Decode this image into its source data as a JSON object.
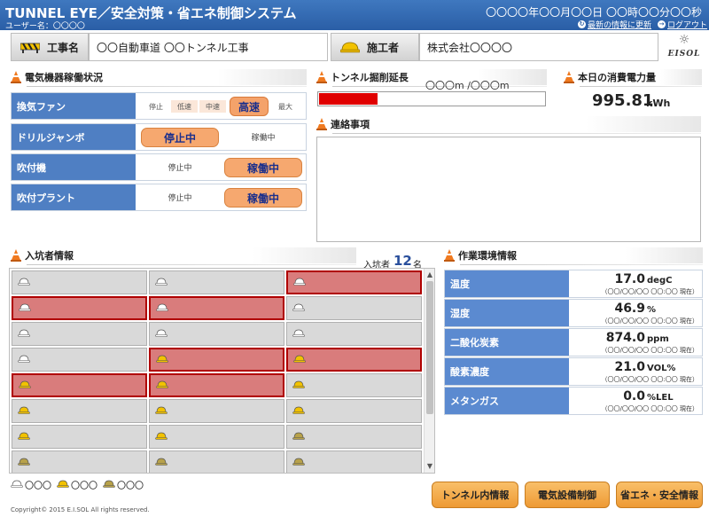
{
  "app": {
    "title": "TUNNEL EYE／安全対策・省エネ制御システム",
    "user_label": "ユーザー名：〇〇〇〇",
    "datetime": "〇〇〇〇年〇〇月〇〇日 〇〇時〇〇分〇〇秒",
    "refresh_link": "最新の情報に更新",
    "logout_link": "ログアウト",
    "logo_text": "EISOL"
  },
  "header": {
    "project_label": "工事名",
    "project_value": "〇〇自動車道 〇〇トンネル工事",
    "contractor_label": "施工者",
    "contractor_value": "株式会社〇〇〇〇"
  },
  "equipment": {
    "title": "電気機器稼働状況",
    "fan": {
      "name": "換気ファン",
      "options": [
        "停止",
        "低速",
        "中速",
        "高速",
        "最大"
      ],
      "selected": "高速"
    },
    "rows": [
      {
        "name": "ドリルジャンボ",
        "stop": "停止中",
        "run": "稼働中",
        "state": "stop"
      },
      {
        "name": "吹付機",
        "stop": "停止中",
        "run": "稼働中",
        "state": "run"
      },
      {
        "name": "吹付プラント",
        "stop": "停止中",
        "run": "稼働中",
        "state": "run"
      }
    ]
  },
  "excavation": {
    "title": "トンネル掘削延長",
    "text": "〇〇〇m /〇〇〇m",
    "progress": 0.26,
    "color": "#e00000"
  },
  "power": {
    "title": "本日の消費電力量",
    "value": "995.81",
    "unit": "kWh"
  },
  "notice": {
    "title": "連絡事項"
  },
  "workers": {
    "title": "入坑者情報",
    "count_label": "入坑者",
    "count": "12",
    "count_unit": "名",
    "rows": [
      [
        {
          "helmet": "white",
          "alert": false
        },
        {
          "helmet": "white",
          "alert": false
        },
        {
          "helmet": "white",
          "alert": true
        }
      ],
      [
        {
          "helmet": "white",
          "alert": true
        },
        {
          "helmet": "white",
          "alert": true
        },
        {
          "helmet": "white",
          "alert": false
        }
      ],
      [
        {
          "helmet": "white",
          "alert": false
        },
        {
          "helmet": "white",
          "alert": false
        },
        {
          "helmet": "white",
          "alert": false
        }
      ],
      [
        {
          "helmet": "white",
          "alert": false
        },
        {
          "helmet": "yellow",
          "alert": true
        },
        {
          "helmet": "yellow",
          "alert": true
        }
      ],
      [
        {
          "helmet": "yellow",
          "alert": true
        },
        {
          "helmet": "yellow",
          "alert": true
        },
        {
          "helmet": "yellow",
          "alert": false
        }
      ],
      [
        {
          "helmet": "yellow",
          "alert": false
        },
        {
          "helmet": "yellow",
          "alert": false
        },
        {
          "helmet": "yellow",
          "alert": false
        }
      ],
      [
        {
          "helmet": "yellow",
          "alert": false
        },
        {
          "helmet": "yellow",
          "alert": false
        },
        {
          "helmet": "olive",
          "alert": false
        }
      ],
      [
        {
          "helmet": "olive",
          "alert": false
        },
        {
          "helmet": "olive",
          "alert": false
        },
        {
          "helmet": "olive",
          "alert": false
        }
      ]
    ],
    "legend": [
      {
        "helmet": "white",
        "label": "〇〇〇"
      },
      {
        "helmet": "yellow",
        "label": "〇〇〇"
      },
      {
        "helmet": "olive",
        "label": "〇〇〇"
      }
    ],
    "helmet_colors": {
      "white": "#ffffff",
      "yellow": "#f2c200",
      "olive": "#b8a24a"
    }
  },
  "environment": {
    "title": "作業環境情報",
    "timestamp": "（〇〇/〇〇/〇〇 〇〇:〇〇 現在）",
    "rows": [
      {
        "name": "温度",
        "value": "17.0",
        "unit": "degC"
      },
      {
        "name": "湿度",
        "value": "46.9",
        "unit": "%"
      },
      {
        "name": "二酸化炭素",
        "value": "874.0",
        "unit": "ppm"
      },
      {
        "name": "酸素濃度",
        "value": "21.0",
        "unit": "VOL%"
      },
      {
        "name": "メタンガス",
        "value": "0.0",
        "unit": "%LEL"
      }
    ]
  },
  "nav": {
    "tunnel": "トンネル内情報",
    "electric": "電気設備制御",
    "safety": "省エネ・安全情報"
  },
  "footer": {
    "copyright": "Copyright© 2015 E.I.SOL All rights reserved."
  }
}
